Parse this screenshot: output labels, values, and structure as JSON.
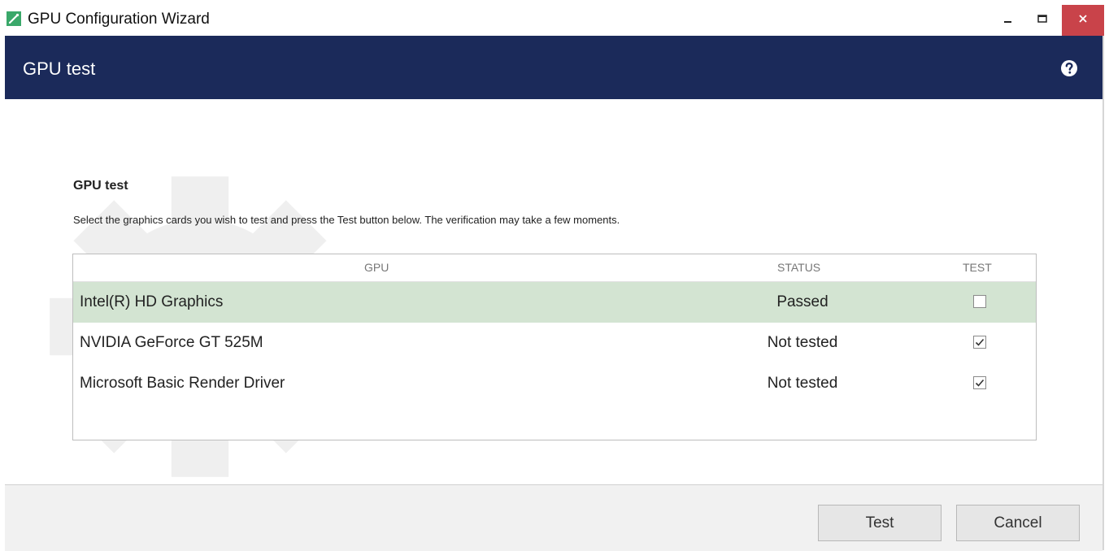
{
  "window": {
    "title": "GPU Configuration Wizard",
    "app_icon": "wizard-app-icon",
    "controls": {
      "minimize": "minimize-icon",
      "maximize": "maximize-icon",
      "close": "close-icon"
    }
  },
  "header": {
    "title": "GPU test",
    "help_icon": "help-icon"
  },
  "main": {
    "section_title": "GPU test",
    "description": "Select the graphics cards you wish to test and press the Test button below. The verification may take a few moments.",
    "table": {
      "columns": [
        "GPU",
        "STATUS",
        "TEST"
      ],
      "rows": [
        {
          "gpu": "Intel(R) HD Graphics",
          "status": "Passed",
          "test_checked": false,
          "selected": true
        },
        {
          "gpu": "NVIDIA GeForce GT 525M",
          "status": "Not tested",
          "test_checked": true,
          "selected": false
        },
        {
          "gpu": "Microsoft Basic Render Driver",
          "status": "Not tested",
          "test_checked": true,
          "selected": false
        }
      ]
    }
  },
  "footer": {
    "test_label": "Test",
    "cancel_label": "Cancel"
  },
  "colors": {
    "header_bg": "#1b2a5a",
    "selected_row": "#d3e4d2",
    "close_button": "#c9434a"
  }
}
